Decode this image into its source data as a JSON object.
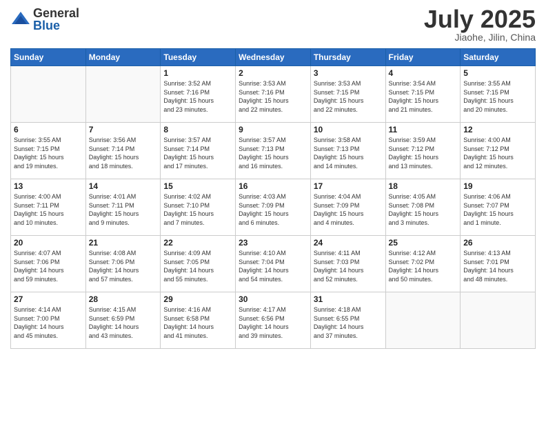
{
  "logo": {
    "general": "General",
    "blue": "Blue"
  },
  "title": "July 2025",
  "location": "Jiaohe, Jilin, China",
  "days_of_week": [
    "Sunday",
    "Monday",
    "Tuesday",
    "Wednesday",
    "Thursday",
    "Friday",
    "Saturday"
  ],
  "weeks": [
    [
      {
        "day": "",
        "info": ""
      },
      {
        "day": "",
        "info": ""
      },
      {
        "day": "1",
        "info": "Sunrise: 3:52 AM\nSunset: 7:16 PM\nDaylight: 15 hours\nand 23 minutes."
      },
      {
        "day": "2",
        "info": "Sunrise: 3:53 AM\nSunset: 7:16 PM\nDaylight: 15 hours\nand 22 minutes."
      },
      {
        "day": "3",
        "info": "Sunrise: 3:53 AM\nSunset: 7:15 PM\nDaylight: 15 hours\nand 22 minutes."
      },
      {
        "day": "4",
        "info": "Sunrise: 3:54 AM\nSunset: 7:15 PM\nDaylight: 15 hours\nand 21 minutes."
      },
      {
        "day": "5",
        "info": "Sunrise: 3:55 AM\nSunset: 7:15 PM\nDaylight: 15 hours\nand 20 minutes."
      }
    ],
    [
      {
        "day": "6",
        "info": "Sunrise: 3:55 AM\nSunset: 7:15 PM\nDaylight: 15 hours\nand 19 minutes."
      },
      {
        "day": "7",
        "info": "Sunrise: 3:56 AM\nSunset: 7:14 PM\nDaylight: 15 hours\nand 18 minutes."
      },
      {
        "day": "8",
        "info": "Sunrise: 3:57 AM\nSunset: 7:14 PM\nDaylight: 15 hours\nand 17 minutes."
      },
      {
        "day": "9",
        "info": "Sunrise: 3:57 AM\nSunset: 7:13 PM\nDaylight: 15 hours\nand 16 minutes."
      },
      {
        "day": "10",
        "info": "Sunrise: 3:58 AM\nSunset: 7:13 PM\nDaylight: 15 hours\nand 14 minutes."
      },
      {
        "day": "11",
        "info": "Sunrise: 3:59 AM\nSunset: 7:12 PM\nDaylight: 15 hours\nand 13 minutes."
      },
      {
        "day": "12",
        "info": "Sunrise: 4:00 AM\nSunset: 7:12 PM\nDaylight: 15 hours\nand 12 minutes."
      }
    ],
    [
      {
        "day": "13",
        "info": "Sunrise: 4:00 AM\nSunset: 7:11 PM\nDaylight: 15 hours\nand 10 minutes."
      },
      {
        "day": "14",
        "info": "Sunrise: 4:01 AM\nSunset: 7:11 PM\nDaylight: 15 hours\nand 9 minutes."
      },
      {
        "day": "15",
        "info": "Sunrise: 4:02 AM\nSunset: 7:10 PM\nDaylight: 15 hours\nand 7 minutes."
      },
      {
        "day": "16",
        "info": "Sunrise: 4:03 AM\nSunset: 7:09 PM\nDaylight: 15 hours\nand 6 minutes."
      },
      {
        "day": "17",
        "info": "Sunrise: 4:04 AM\nSunset: 7:09 PM\nDaylight: 15 hours\nand 4 minutes."
      },
      {
        "day": "18",
        "info": "Sunrise: 4:05 AM\nSunset: 7:08 PM\nDaylight: 15 hours\nand 3 minutes."
      },
      {
        "day": "19",
        "info": "Sunrise: 4:06 AM\nSunset: 7:07 PM\nDaylight: 15 hours\nand 1 minute."
      }
    ],
    [
      {
        "day": "20",
        "info": "Sunrise: 4:07 AM\nSunset: 7:06 PM\nDaylight: 14 hours\nand 59 minutes."
      },
      {
        "day": "21",
        "info": "Sunrise: 4:08 AM\nSunset: 7:06 PM\nDaylight: 14 hours\nand 57 minutes."
      },
      {
        "day": "22",
        "info": "Sunrise: 4:09 AM\nSunset: 7:05 PM\nDaylight: 14 hours\nand 55 minutes."
      },
      {
        "day": "23",
        "info": "Sunrise: 4:10 AM\nSunset: 7:04 PM\nDaylight: 14 hours\nand 54 minutes."
      },
      {
        "day": "24",
        "info": "Sunrise: 4:11 AM\nSunset: 7:03 PM\nDaylight: 14 hours\nand 52 minutes."
      },
      {
        "day": "25",
        "info": "Sunrise: 4:12 AM\nSunset: 7:02 PM\nDaylight: 14 hours\nand 50 minutes."
      },
      {
        "day": "26",
        "info": "Sunrise: 4:13 AM\nSunset: 7:01 PM\nDaylight: 14 hours\nand 48 minutes."
      }
    ],
    [
      {
        "day": "27",
        "info": "Sunrise: 4:14 AM\nSunset: 7:00 PM\nDaylight: 14 hours\nand 45 minutes."
      },
      {
        "day": "28",
        "info": "Sunrise: 4:15 AM\nSunset: 6:59 PM\nDaylight: 14 hours\nand 43 minutes."
      },
      {
        "day": "29",
        "info": "Sunrise: 4:16 AM\nSunset: 6:58 PM\nDaylight: 14 hours\nand 41 minutes."
      },
      {
        "day": "30",
        "info": "Sunrise: 4:17 AM\nSunset: 6:56 PM\nDaylight: 14 hours\nand 39 minutes."
      },
      {
        "day": "31",
        "info": "Sunrise: 4:18 AM\nSunset: 6:55 PM\nDaylight: 14 hours\nand 37 minutes."
      },
      {
        "day": "",
        "info": ""
      },
      {
        "day": "",
        "info": ""
      }
    ]
  ]
}
